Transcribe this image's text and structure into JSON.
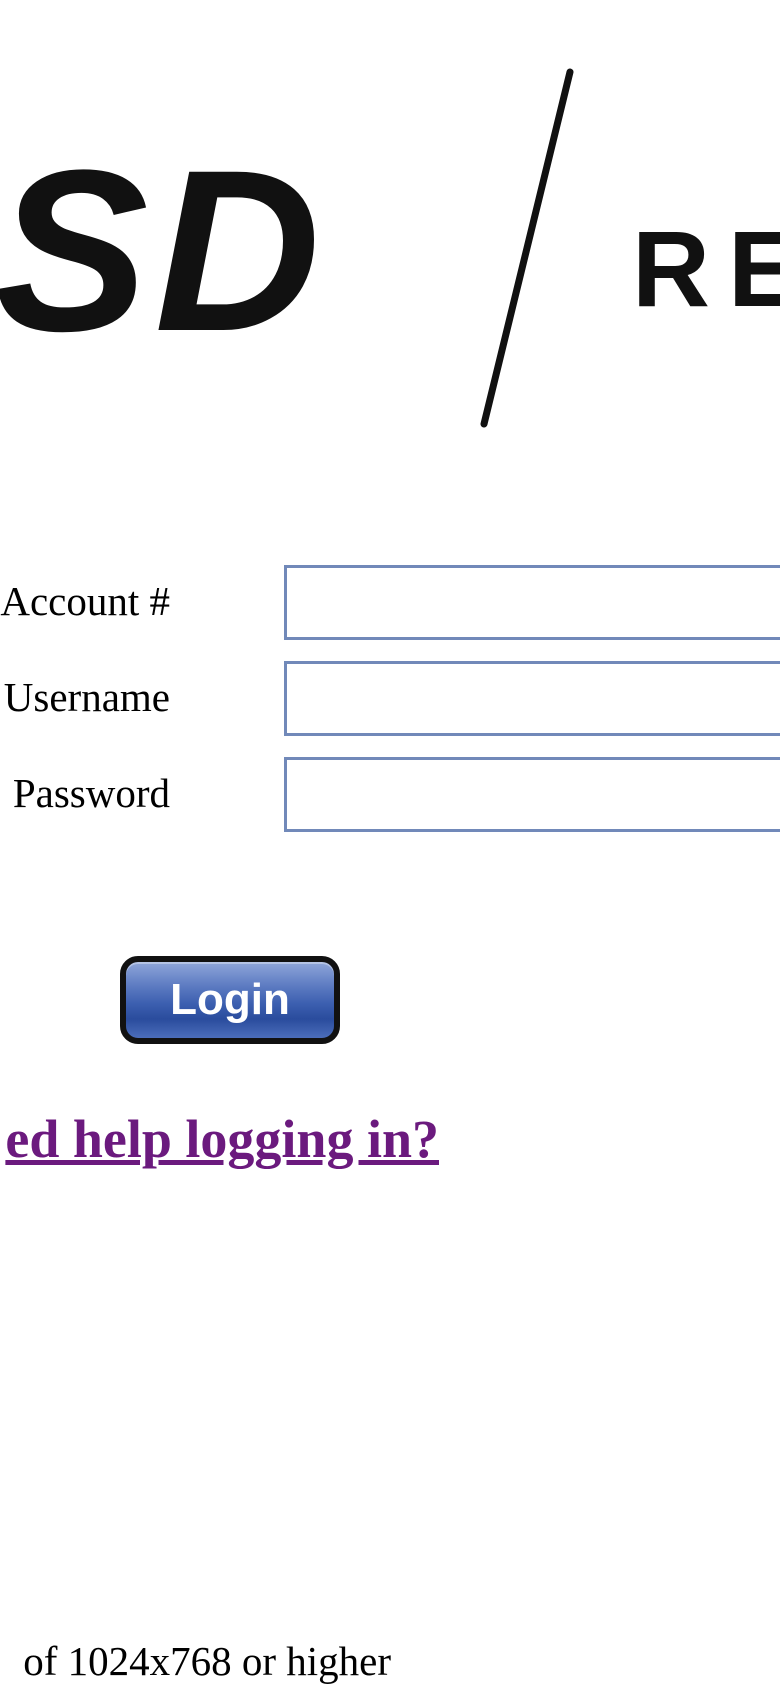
{
  "logo": {
    "left_text": "SD",
    "right_text": "RE"
  },
  "form": {
    "account_label": "Account #",
    "account_value": "",
    "username_label": "Username",
    "username_value": "",
    "password_label": "Password",
    "password_value": ""
  },
  "login_button_label": "Login",
  "help_link_text": "ed help logging in?",
  "resolution_note": "of 1024x768 or higher",
  "colors": {
    "input_border": "#7189b9",
    "button_blue": "#3c5fb0",
    "link_purple": "#6b1a7e"
  }
}
